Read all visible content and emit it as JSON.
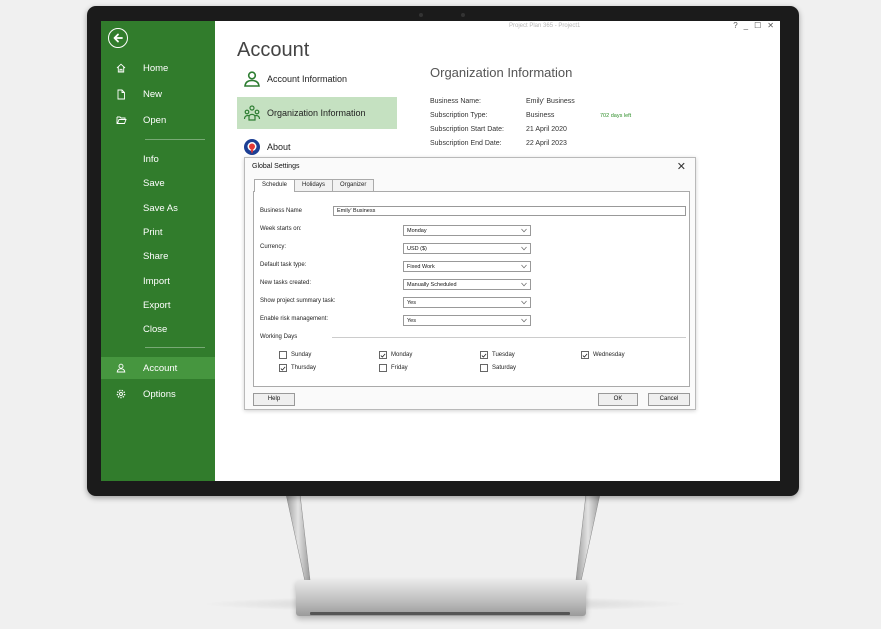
{
  "app": {
    "window_title": "Project Plan 365 - Project1",
    "controls": {
      "help": "?",
      "minimize": "_",
      "maximize": "☐",
      "close": "✕"
    }
  },
  "sidebar": {
    "nav": [
      {
        "label": "Home",
        "icon": "home-icon"
      },
      {
        "label": "New",
        "icon": "new-document-icon"
      },
      {
        "label": "Open",
        "icon": "open-folder-icon"
      }
    ],
    "commands": [
      {
        "label": "Info"
      },
      {
        "label": "Save"
      },
      {
        "label": "Save As"
      },
      {
        "label": "Print"
      },
      {
        "label": "Share"
      },
      {
        "label": "Import"
      },
      {
        "label": "Export"
      },
      {
        "label": "Close"
      }
    ],
    "account": {
      "label": "Account",
      "icon": "account-icon"
    },
    "options": {
      "label": "Options",
      "icon": "gear-icon"
    }
  },
  "account_page": {
    "title": "Account",
    "items": [
      {
        "label": "Account Information",
        "icon": "person-icon"
      },
      {
        "label": "Organization Information",
        "icon": "organization-icon"
      },
      {
        "label": "About",
        "icon": "about-logo-icon"
      }
    ]
  },
  "org_info": {
    "title": "Organization Information",
    "rows": [
      {
        "key": "Business Name:",
        "value": "Emily' Business",
        "note": ""
      },
      {
        "key": "Subscription Type:",
        "value": "Business",
        "note": "702 days left"
      },
      {
        "key": "Subscription Start Date:",
        "value": "21 April 2020",
        "note": ""
      },
      {
        "key": "Subscription End Date:",
        "value": "22 April 2023",
        "note": ""
      }
    ]
  },
  "dialog": {
    "title": "Global Settings",
    "close": "✕",
    "tabs": [
      "Schedule",
      "Holidays",
      "Organizer"
    ],
    "business_name_label": "Business Name",
    "business_name_value": "Emily' Business",
    "fields": [
      {
        "label": "Week starts on:",
        "value": "Monday"
      },
      {
        "label": "Currency:",
        "value": "USD ($)"
      },
      {
        "label": "Default task type:",
        "value": "Fixed Work"
      },
      {
        "label": "New tasks created:",
        "value": "Manually Scheduled"
      },
      {
        "label": "Show project summary task:",
        "value": "Yes"
      },
      {
        "label": "Enable risk management:",
        "value": "Yes"
      }
    ],
    "working_days_label": "Working Days",
    "days": [
      {
        "label": "Sunday",
        "checked": false
      },
      {
        "label": "Monday",
        "checked": true
      },
      {
        "label": "Tuesday",
        "checked": true
      },
      {
        "label": "Wednesday",
        "checked": true
      },
      {
        "label": "Thursday",
        "checked": true
      },
      {
        "label": "Friday",
        "checked": false
      },
      {
        "label": "Saturday",
        "checked": false
      }
    ],
    "buttons": {
      "help": "Help",
      "ok": "OK",
      "cancel": "Cancel"
    }
  },
  "colors": {
    "sidebar": "#317c2c",
    "sidebar_selected": "#46963f",
    "selected_item_bg": "#c5e1c1",
    "days_left": "#2f8f2a"
  }
}
